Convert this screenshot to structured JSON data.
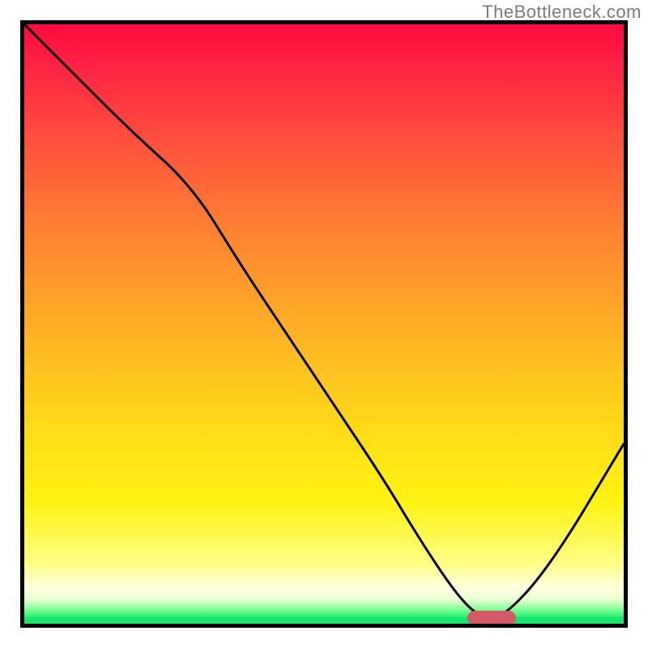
{
  "watermark": "TheBottleneck.com",
  "chart_data": {
    "type": "line",
    "title": "",
    "xlabel": "",
    "ylabel": "",
    "xlim": [
      0,
      100
    ],
    "ylim": [
      0,
      100
    ],
    "grid": false,
    "legend": null,
    "series": [
      {
        "name": "bottleneck-curve",
        "x": [
          0,
          8,
          18,
          28,
          36,
          44,
          52,
          60,
          66,
          72,
          76,
          80,
          88,
          100
        ],
        "values": [
          100,
          92,
          82,
          73,
          60,
          48,
          36,
          24,
          14,
          5,
          1,
          1,
          10,
          30
        ]
      }
    ],
    "marker": {
      "x": 78,
      "y": 1,
      "kind": "pill",
      "color": "#d35b66"
    },
    "background": "heatmap-gradient-red-to-green",
    "gradient_stops": [
      {
        "pos": 0,
        "color": "#ff0a3c"
      },
      {
        "pos": 50,
        "color": "#ffb020"
      },
      {
        "pos": 80,
        "color": "#fff314"
      },
      {
        "pos": 96,
        "color": "#e9ffd0"
      },
      {
        "pos": 100,
        "color": "#17e56e"
      }
    ]
  },
  "colors": {
    "curve": "#000000",
    "border": "#000000",
    "watermark": "#7a7a7a",
    "pill": "#d35b66"
  }
}
